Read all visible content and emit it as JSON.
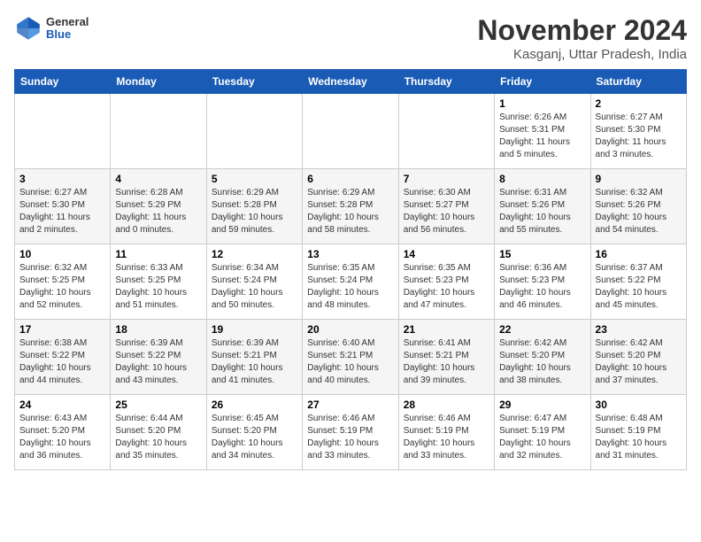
{
  "header": {
    "logo_general": "General",
    "logo_blue": "Blue",
    "month_title": "November 2024",
    "location": "Kasganj, Uttar Pradesh, India"
  },
  "weekdays": [
    "Sunday",
    "Monday",
    "Tuesday",
    "Wednesday",
    "Thursday",
    "Friday",
    "Saturday"
  ],
  "weeks": [
    [
      {
        "day": "",
        "info": ""
      },
      {
        "day": "",
        "info": ""
      },
      {
        "day": "",
        "info": ""
      },
      {
        "day": "",
        "info": ""
      },
      {
        "day": "",
        "info": ""
      },
      {
        "day": "1",
        "info": "Sunrise: 6:26 AM\nSunset: 5:31 PM\nDaylight: 11 hours\nand 5 minutes."
      },
      {
        "day": "2",
        "info": "Sunrise: 6:27 AM\nSunset: 5:30 PM\nDaylight: 11 hours\nand 3 minutes."
      }
    ],
    [
      {
        "day": "3",
        "info": "Sunrise: 6:27 AM\nSunset: 5:30 PM\nDaylight: 11 hours\nand 2 minutes."
      },
      {
        "day": "4",
        "info": "Sunrise: 6:28 AM\nSunset: 5:29 PM\nDaylight: 11 hours\nand 0 minutes."
      },
      {
        "day": "5",
        "info": "Sunrise: 6:29 AM\nSunset: 5:28 PM\nDaylight: 10 hours\nand 59 minutes."
      },
      {
        "day": "6",
        "info": "Sunrise: 6:29 AM\nSunset: 5:28 PM\nDaylight: 10 hours\nand 58 minutes."
      },
      {
        "day": "7",
        "info": "Sunrise: 6:30 AM\nSunset: 5:27 PM\nDaylight: 10 hours\nand 56 minutes."
      },
      {
        "day": "8",
        "info": "Sunrise: 6:31 AM\nSunset: 5:26 PM\nDaylight: 10 hours\nand 55 minutes."
      },
      {
        "day": "9",
        "info": "Sunrise: 6:32 AM\nSunset: 5:26 PM\nDaylight: 10 hours\nand 54 minutes."
      }
    ],
    [
      {
        "day": "10",
        "info": "Sunrise: 6:32 AM\nSunset: 5:25 PM\nDaylight: 10 hours\nand 52 minutes."
      },
      {
        "day": "11",
        "info": "Sunrise: 6:33 AM\nSunset: 5:25 PM\nDaylight: 10 hours\nand 51 minutes."
      },
      {
        "day": "12",
        "info": "Sunrise: 6:34 AM\nSunset: 5:24 PM\nDaylight: 10 hours\nand 50 minutes."
      },
      {
        "day": "13",
        "info": "Sunrise: 6:35 AM\nSunset: 5:24 PM\nDaylight: 10 hours\nand 48 minutes."
      },
      {
        "day": "14",
        "info": "Sunrise: 6:35 AM\nSunset: 5:23 PM\nDaylight: 10 hours\nand 47 minutes."
      },
      {
        "day": "15",
        "info": "Sunrise: 6:36 AM\nSunset: 5:23 PM\nDaylight: 10 hours\nand 46 minutes."
      },
      {
        "day": "16",
        "info": "Sunrise: 6:37 AM\nSunset: 5:22 PM\nDaylight: 10 hours\nand 45 minutes."
      }
    ],
    [
      {
        "day": "17",
        "info": "Sunrise: 6:38 AM\nSunset: 5:22 PM\nDaylight: 10 hours\nand 44 minutes."
      },
      {
        "day": "18",
        "info": "Sunrise: 6:39 AM\nSunset: 5:22 PM\nDaylight: 10 hours\nand 43 minutes."
      },
      {
        "day": "19",
        "info": "Sunrise: 6:39 AM\nSunset: 5:21 PM\nDaylight: 10 hours\nand 41 minutes."
      },
      {
        "day": "20",
        "info": "Sunrise: 6:40 AM\nSunset: 5:21 PM\nDaylight: 10 hours\nand 40 minutes."
      },
      {
        "day": "21",
        "info": "Sunrise: 6:41 AM\nSunset: 5:21 PM\nDaylight: 10 hours\nand 39 minutes."
      },
      {
        "day": "22",
        "info": "Sunrise: 6:42 AM\nSunset: 5:20 PM\nDaylight: 10 hours\nand 38 minutes."
      },
      {
        "day": "23",
        "info": "Sunrise: 6:42 AM\nSunset: 5:20 PM\nDaylight: 10 hours\nand 37 minutes."
      }
    ],
    [
      {
        "day": "24",
        "info": "Sunrise: 6:43 AM\nSunset: 5:20 PM\nDaylight: 10 hours\nand 36 minutes."
      },
      {
        "day": "25",
        "info": "Sunrise: 6:44 AM\nSunset: 5:20 PM\nDaylight: 10 hours\nand 35 minutes."
      },
      {
        "day": "26",
        "info": "Sunrise: 6:45 AM\nSunset: 5:20 PM\nDaylight: 10 hours\nand 34 minutes."
      },
      {
        "day": "27",
        "info": "Sunrise: 6:46 AM\nSunset: 5:19 PM\nDaylight: 10 hours\nand 33 minutes."
      },
      {
        "day": "28",
        "info": "Sunrise: 6:46 AM\nSunset: 5:19 PM\nDaylight: 10 hours\nand 33 minutes."
      },
      {
        "day": "29",
        "info": "Sunrise: 6:47 AM\nSunset: 5:19 PM\nDaylight: 10 hours\nand 32 minutes."
      },
      {
        "day": "30",
        "info": "Sunrise: 6:48 AM\nSunset: 5:19 PM\nDaylight: 10 hours\nand 31 minutes."
      }
    ]
  ]
}
